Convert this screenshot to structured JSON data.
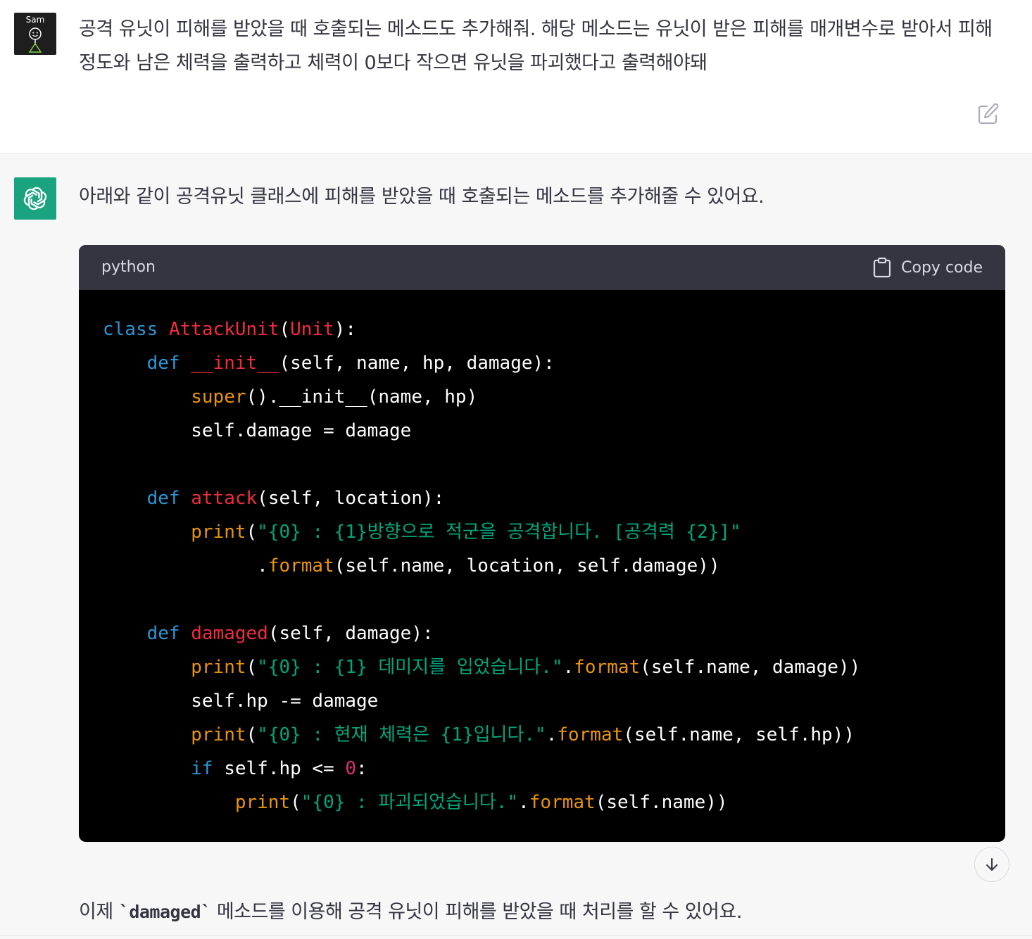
{
  "user_message": {
    "avatar_label": "Sam",
    "text": "공격 유닛이 피해를 받았을 때 호출되는 메소드도 추가해줘. 해당 메소드는 유닛이 받은 피해를 매개변수로 받아서 피해정도와 남은 체력을 출력하고 체력이 0보다 작으면 유닛을 파괴했다고 출력해야돼",
    "edit_icon": "edit-icon"
  },
  "assistant_message": {
    "avatar_icon": "openai-logo-icon",
    "intro": "아래와 같이 공격유닛 클래스에 피해를 받았을 때 호출되는 메소드를 추가해줄 수 있어요.",
    "code_block": {
      "language": "python",
      "copy_label": "Copy code",
      "copy_icon": "clipboard-icon",
      "lines": [
        [
          {
            "t": "kw",
            "v": "class"
          },
          {
            "t": "plain",
            "v": " "
          },
          {
            "t": "cls",
            "v": "AttackUnit"
          },
          {
            "t": "plain",
            "v": "("
          },
          {
            "t": "cls",
            "v": "Unit"
          },
          {
            "t": "plain",
            "v": "):"
          }
        ],
        [
          {
            "t": "plain",
            "v": "    "
          },
          {
            "t": "kw",
            "v": "def"
          },
          {
            "t": "plain",
            "v": " "
          },
          {
            "t": "fn",
            "v": "__init__"
          },
          {
            "t": "plain",
            "v": "(self, name, hp, damage):"
          }
        ],
        [
          {
            "t": "plain",
            "v": "        "
          },
          {
            "t": "bi",
            "v": "super"
          },
          {
            "t": "plain",
            "v": "().__init__(name, hp)"
          }
        ],
        [
          {
            "t": "plain",
            "v": "        self.damage = damage"
          }
        ],
        [],
        [
          {
            "t": "plain",
            "v": "    "
          },
          {
            "t": "kw",
            "v": "def"
          },
          {
            "t": "plain",
            "v": " "
          },
          {
            "t": "fn",
            "v": "attack"
          },
          {
            "t": "plain",
            "v": "(self, location):"
          }
        ],
        [
          {
            "t": "plain",
            "v": "        "
          },
          {
            "t": "bi",
            "v": "print"
          },
          {
            "t": "plain",
            "v": "("
          },
          {
            "t": "str",
            "v": "\"{0} : {1}방향으로 적군을 공격합니다. [공격력 {2}]\""
          }
        ],
        [
          {
            "t": "plain",
            "v": "              ."
          },
          {
            "t": "bi",
            "v": "format"
          },
          {
            "t": "plain",
            "v": "(self.name, location, self.damage))"
          }
        ],
        [],
        [
          {
            "t": "plain",
            "v": "    "
          },
          {
            "t": "kw",
            "v": "def"
          },
          {
            "t": "plain",
            "v": " "
          },
          {
            "t": "fn",
            "v": "damaged"
          },
          {
            "t": "plain",
            "v": "(self, damage):"
          }
        ],
        [
          {
            "t": "plain",
            "v": "        "
          },
          {
            "t": "bi",
            "v": "print"
          },
          {
            "t": "plain",
            "v": "("
          },
          {
            "t": "str",
            "v": "\"{0} : {1} 데미지를 입었습니다.\""
          },
          {
            "t": "plain",
            "v": "."
          },
          {
            "t": "bi",
            "v": "format"
          },
          {
            "t": "plain",
            "v": "(self.name, damage))"
          }
        ],
        [
          {
            "t": "plain",
            "v": "        self.hp -= damage"
          }
        ],
        [
          {
            "t": "plain",
            "v": "        "
          },
          {
            "t": "bi",
            "v": "print"
          },
          {
            "t": "plain",
            "v": "("
          },
          {
            "t": "str",
            "v": "\"{0} : 현재 체력은 {1}입니다.\""
          },
          {
            "t": "plain",
            "v": "."
          },
          {
            "t": "bi",
            "v": "format"
          },
          {
            "t": "plain",
            "v": "(self.name, self.hp))"
          }
        ],
        [
          {
            "t": "plain",
            "v": "        "
          },
          {
            "t": "kw",
            "v": "if"
          },
          {
            "t": "plain",
            "v": " self.hp <= "
          },
          {
            "t": "num",
            "v": "0"
          },
          {
            "t": "plain",
            "v": ":"
          }
        ],
        [
          {
            "t": "plain",
            "v": "            "
          },
          {
            "t": "bi",
            "v": "print"
          },
          {
            "t": "plain",
            "v": "("
          },
          {
            "t": "str",
            "v": "\"{0} : 파괴되었습니다.\""
          },
          {
            "t": "plain",
            "v": "."
          },
          {
            "t": "bi",
            "v": "format"
          },
          {
            "t": "plain",
            "v": "(self.name))"
          }
        ]
      ]
    },
    "outro_prefix": "이제 ",
    "outro_code": "`damaged`",
    "outro_suffix": " 메소드를 이용해 공격 유닛이 피해를 받았을 때 처리를 할 수 있어요."
  },
  "scroll_button_icon": "arrow-down-icon",
  "colors": {
    "assistant_avatar": "#19a37f",
    "code_header": "#343541",
    "keyword": "#2e95d3",
    "class_name": "#f22c3d",
    "builtin": "#e9950c",
    "string": "#00a67d",
    "number": "#df3079"
  }
}
